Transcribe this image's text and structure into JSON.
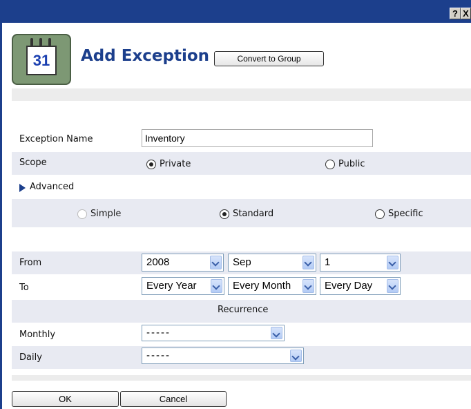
{
  "titlebar": {
    "help_label": "?",
    "close_label": "X"
  },
  "header": {
    "calendar_number": "31",
    "title": "Add Exception",
    "convert_button": "Convert to Group"
  },
  "form": {
    "exception_name_label": "Exception Name",
    "exception_name_value": "Inventory",
    "scope_label": "Scope",
    "scope_private": "Private",
    "scope_public": "Public",
    "advanced_label": "Advanced",
    "mode_simple": "Simple",
    "mode_standard": "Standard",
    "mode_specific": "Specific",
    "from_label": "From",
    "from_year": "2008",
    "from_month": "Sep",
    "from_day": "1",
    "to_label": "To",
    "to_year": "Every Year",
    "to_month": "Every Month",
    "to_day": "Every Day",
    "recurrence_label": "Recurrence",
    "monthly_label": "Monthly",
    "monthly_value": "-----",
    "daily_label": "Daily",
    "daily_value": "-----"
  },
  "footer": {
    "ok_label": "OK",
    "cancel_label": "Cancel"
  },
  "colors": {
    "titlebar": "#1c3f8c",
    "row_shade": "#e8eaf2",
    "title_text": "#1c3f8c"
  }
}
